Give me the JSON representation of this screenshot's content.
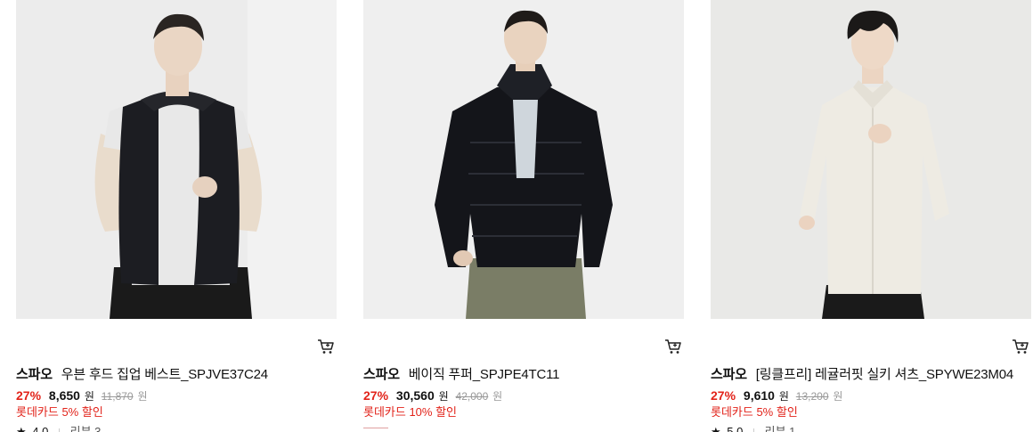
{
  "products": [
    {
      "brand": "스파오",
      "name": "우븐 후드 집업 베스트_SPJVE37C24",
      "discount": "27%",
      "price": "8,650",
      "price_unit": "원",
      "original_price": "11,870",
      "original_unit": "원",
      "card_promo": "롯데카드 5% 할인",
      "rating": "4.0",
      "review": "리뷰 3",
      "image_icon": "model-wearing-black-hooded-vest"
    },
    {
      "brand": "스파오",
      "name": "베이직 푸퍼_SPJPE4TC11",
      "discount": "27%",
      "price": "30,560",
      "price_unit": "원",
      "original_price": "42,000",
      "original_unit": "원",
      "card_promo": "롯데카드 10% 할인",
      "image_icon": "model-wearing-black-puffer-jacket"
    },
    {
      "brand": "스파오",
      "name": "[링클프리] 레귤러핏 실키 셔츠_SPYWE23M04",
      "discount": "27%",
      "price": "9,610",
      "price_unit": "원",
      "original_price": "13,200",
      "original_unit": "원",
      "card_promo": "롯데카드 5% 할인",
      "rating": "5.0",
      "review": "리뷰 1",
      "image_icon": "model-wearing-white-shirt"
    }
  ],
  "icons": {
    "cart": "cart-icon",
    "star": "star-icon"
  },
  "colors": {
    "accent_red": "#e2231a",
    "strike_gray": "#999999",
    "text": "#111111"
  }
}
